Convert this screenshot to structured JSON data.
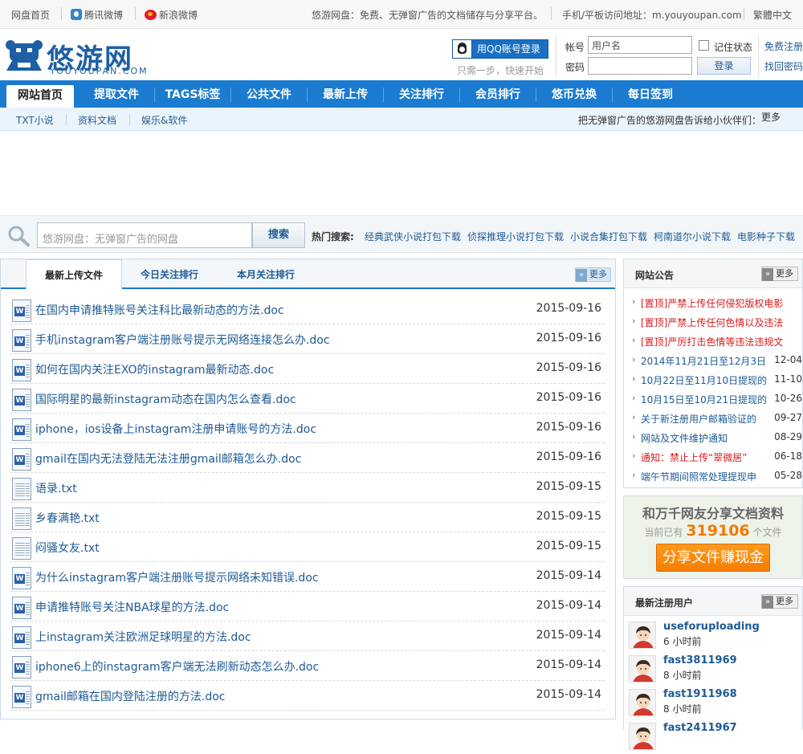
{
  "topbar": {
    "home": "网盘首页",
    "qq_weibo": "腾讯微博",
    "sina_weibo": "新浪微博",
    "slogan": "悠游网盘：免费、无弹窗广告的文档储存与分享平台。",
    "mobile": "手机/平板访问地址：m.youyoupan.com",
    "traditional": "繁體中文"
  },
  "logo": {
    "text": "悠游网盘",
    "sub": "YOUYOUPAN.COM"
  },
  "login": {
    "qq_button": "用QQ账号登录",
    "qq_hint": "只需一步，快速开始",
    "account_label": "帐号",
    "password_label": "密码",
    "username_value": "用户名",
    "remember": "记住状态",
    "login_button": "登录",
    "register": "免费注册",
    "forgot": "找回密码"
  },
  "nav": {
    "items": [
      "网站首页",
      "提取文件",
      "TAGS标签",
      "公共文件",
      "最新上传",
      "关注排行",
      "会员排行",
      "悠币兑换",
      "每日签到"
    ]
  },
  "subnav": {
    "items": [
      "TXT小说",
      "资料文档",
      "娱乐&软件"
    ],
    "notice": "把无弹窗广告的悠游网盘告诉给小伙伴们：",
    "notice_more": "更多"
  },
  "search": {
    "placeholder": "悠游网盘：无弹窗广告的网盘",
    "button": "搜索",
    "hot_label": "热门搜索:",
    "hot": [
      "经典武侠小说打包下载",
      "侦探推理小说打包下载",
      "小说合集打包下载",
      "柯南道尔小说下载",
      "电影种子下载"
    ]
  },
  "files": {
    "tabs": [
      "最新上传文件",
      "今日关注排行",
      "本月关注排行"
    ],
    "more": "更多",
    "rows": [
      {
        "name": "在国内申请推特账号关注科比最新动态的方法.doc",
        "date": "2015-09-16",
        "type": "doc"
      },
      {
        "name": "手机instagram客户端注册账号提示无网络连接怎么办.doc",
        "date": "2015-09-16",
        "type": "doc"
      },
      {
        "name": "如何在国内关注EXO的instagram最新动态.doc",
        "date": "2015-09-16",
        "type": "doc"
      },
      {
        "name": "国际明星的最新instagram动态在国内怎么查看.doc",
        "date": "2015-09-16",
        "type": "doc"
      },
      {
        "name": "iphone，ios设备上instagram注册申请账号的方法.doc",
        "date": "2015-09-16",
        "type": "doc"
      },
      {
        "name": "gmail在国内无法登陆无法注册gmail邮箱怎么办.doc",
        "date": "2015-09-16",
        "type": "doc"
      },
      {
        "name": "语录.txt",
        "date": "2015-09-15",
        "type": "txt"
      },
      {
        "name": "乡春满艳.txt",
        "date": "2015-09-15",
        "type": "txt"
      },
      {
        "name": "闷骚女友.txt",
        "date": "2015-09-15",
        "type": "txt"
      },
      {
        "name": "为什么instagram客户端注册账号提示网络未知错误.doc",
        "date": "2015-09-14",
        "type": "doc"
      },
      {
        "name": "申请推特账号关注NBA球星的方法.doc",
        "date": "2015-09-14",
        "type": "doc"
      },
      {
        "name": "上instagram关注欧洲足球明星的方法.doc",
        "date": "2015-09-14",
        "type": "doc"
      },
      {
        "name": "iphone6上的instagram客户端无法刷新动态怎么办.doc",
        "date": "2015-09-14",
        "type": "doc"
      },
      {
        "name": "gmail邮箱在国内登陆注册的方法.doc",
        "date": "2015-09-14",
        "type": "doc"
      }
    ]
  },
  "announcements": {
    "title": "网站公告",
    "more": "更多",
    "items": [
      {
        "text": "[置顶]严禁上传任何侵犯版权电影文",
        "date": "",
        "red": true
      },
      {
        "text": "[置顶]严禁上传任何色情以及违法违",
        "date": "",
        "red": true
      },
      {
        "text": "[置顶]严厉打击色情等违法违规文件",
        "date": "",
        "red": true
      },
      {
        "text": "2014年11月21日至12月3日",
        "date": "12-04",
        "red": false
      },
      {
        "text": "10月22日至11月10日提现的",
        "date": "11-10",
        "red": false
      },
      {
        "text": "10月15日至10月21日提现的",
        "date": "10-26",
        "red": false
      },
      {
        "text": "关于新注册用户邮箱验证的",
        "date": "09-27",
        "red": false
      },
      {
        "text": "网站及文件维护通知",
        "date": "08-29",
        "red": false
      },
      {
        "text": "通知：禁止上传“翠微居”",
        "date": "06-18",
        "red": true
      },
      {
        "text": "端午节期间照常处理提现申",
        "date": "05-28",
        "red": false
      }
    ]
  },
  "share": {
    "headline": "和万千网友分享文档资料",
    "count_prefix": "当前已有",
    "count": "319106",
    "count_suffix": "个文件",
    "button": "分享文件赚现金"
  },
  "users": {
    "title": "最新注册用户",
    "more": "更多",
    "items": [
      {
        "name": "useforuploading",
        "time": "6 小时前"
      },
      {
        "name": "fast3811969",
        "time": "8 小时前"
      },
      {
        "name": "fast1911968",
        "time": "8 小时前"
      },
      {
        "name": "fast2411967",
        "time": ""
      }
    ]
  },
  "colors": {
    "nav_blue": "#1a7bd0",
    "link_blue": "#1d5a95",
    "orange": "#f57e00",
    "red": "#d81a1a"
  }
}
